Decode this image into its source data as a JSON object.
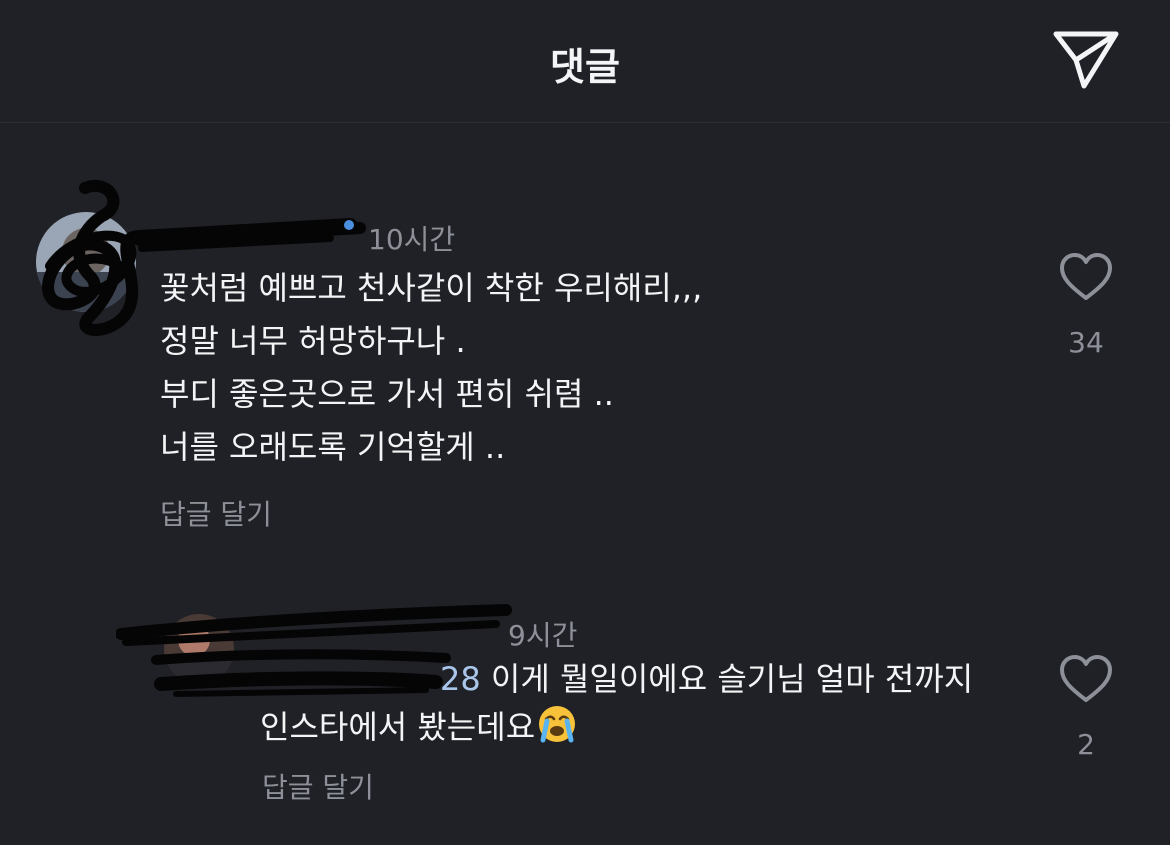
{
  "header": {
    "title": "댓글",
    "share_icon": "paper-plane-icon"
  },
  "comments": [
    {
      "time": "10시간",
      "lines": [
        "꽃처럼 예쁘고 천사같이 착한 우리해리,,,",
        "정말 너무 허망하구나 .",
        "부디 좋은곳으로 가서 편히 쉬렴 ..",
        "너를 오래도록 기억할게 .."
      ],
      "reply_label": "답글 달기",
      "like_count": "34",
      "like_icon": "heart-outline-icon"
    }
  ],
  "replies": [
    {
      "time": "9시간",
      "mention_fragment": "28",
      "line1": " 이게 뭘일이에요 슬기님 얼마 전까지",
      "line2": "인스타에서 봤는데요",
      "emoji": "loudly-crying-face-emoji",
      "reply_label": "답글 달기",
      "like_count": "2",
      "like_icon": "heart-outline-icon"
    }
  ],
  "colors": {
    "background": "#1f2126",
    "text_primary": "#f3f4f6",
    "text_secondary": "#8d9098",
    "mention": "#a9c6ea"
  }
}
